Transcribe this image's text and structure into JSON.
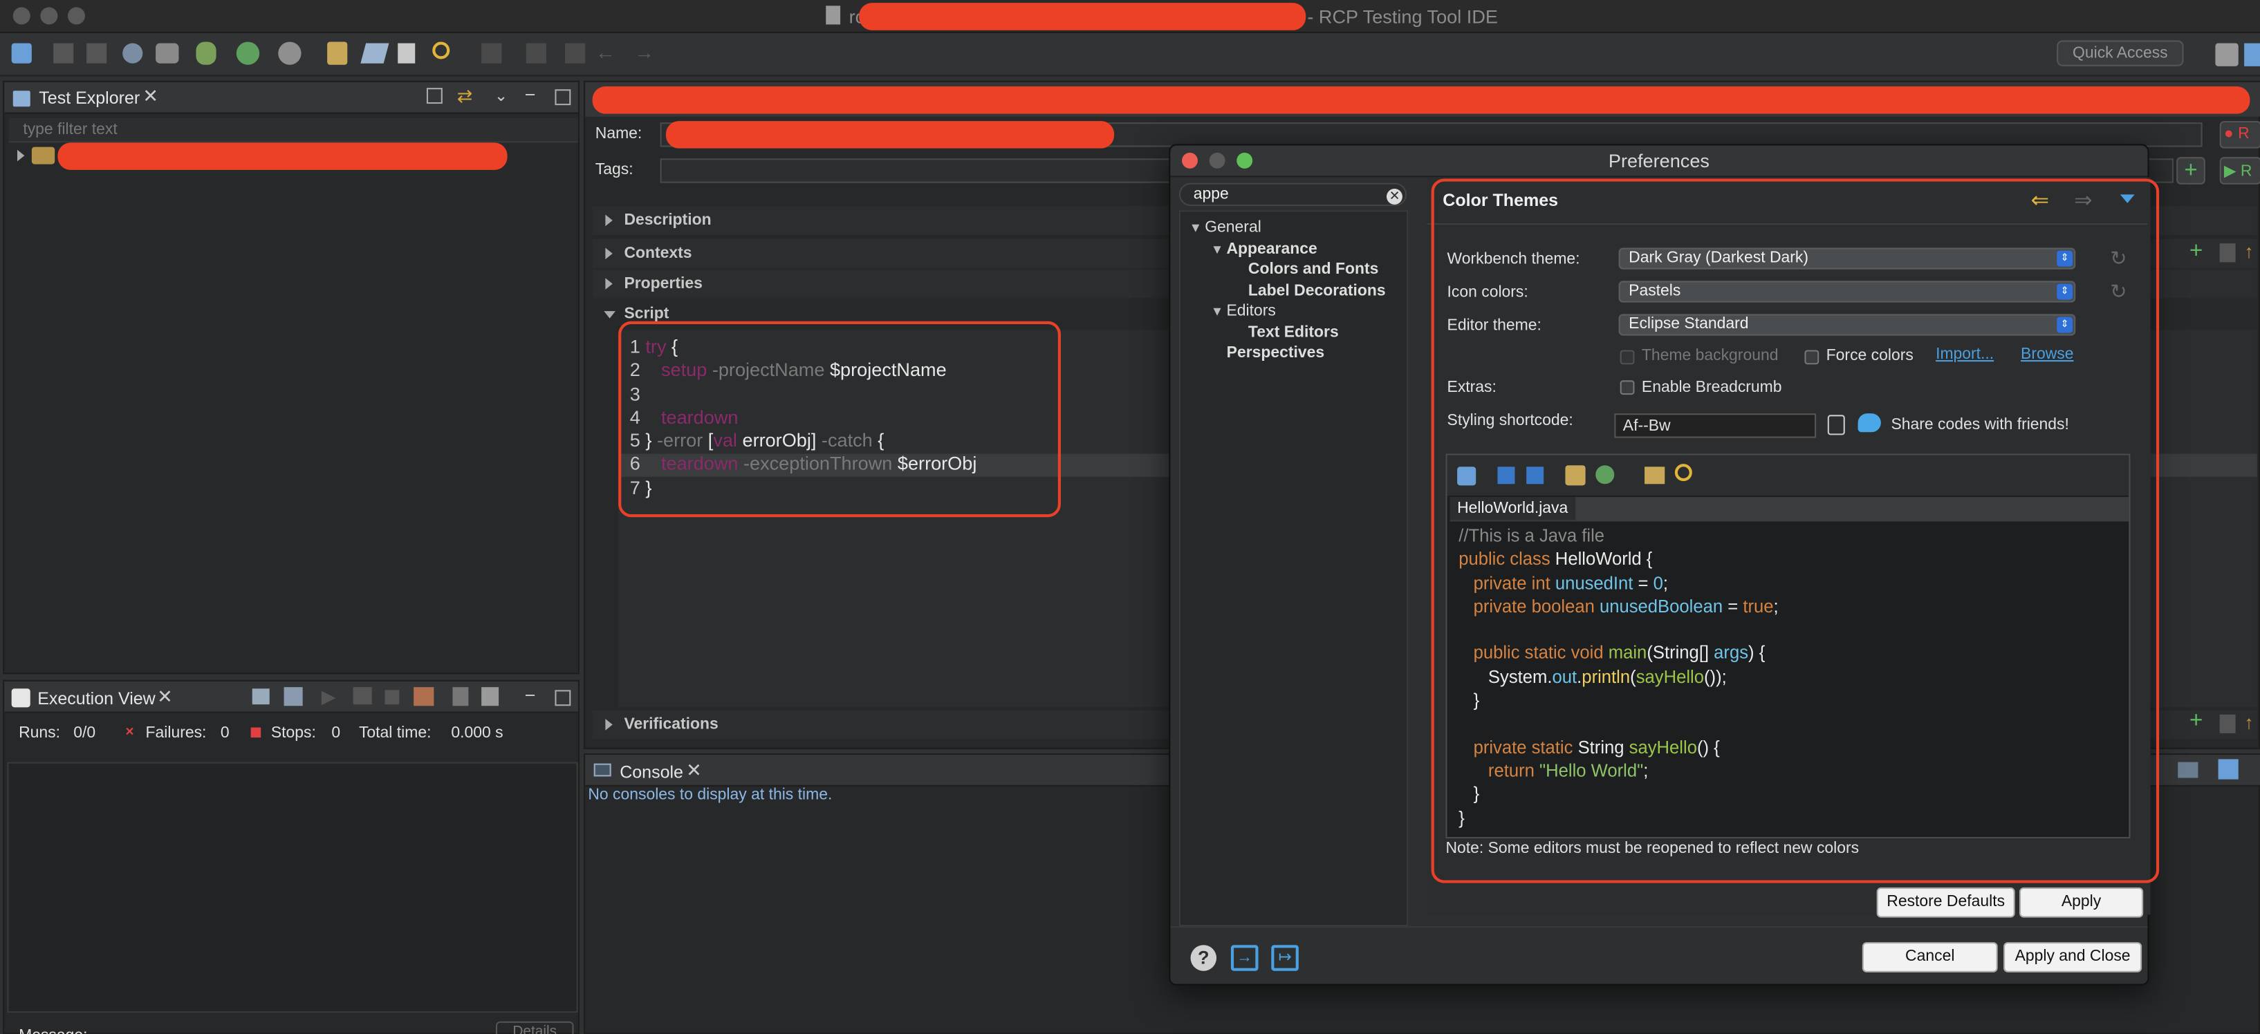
{
  "window": {
    "title": "- RCP Testing Tool IDE",
    "title_prefix": "rc"
  },
  "toolbar": {
    "quick_access": "Quick Access"
  },
  "test_explorer": {
    "tab": "Test Explorer",
    "filter_placeholder": "type filter text"
  },
  "editor": {
    "name_label": "Name:",
    "tags_label": "Tags:",
    "sections": {
      "description": "Description",
      "contexts": "Contexts",
      "properties": "Properties",
      "script": "Script",
      "verifications": "Verifications"
    },
    "script_lines": [
      {
        "n": "1",
        "parts": [
          [
            "kw",
            "try"
          ],
          [
            "wh",
            " {"
          ]
        ]
      },
      {
        "n": "2",
        "parts": [
          [
            "wh",
            "   "
          ],
          [
            "kw",
            "setup"
          ],
          [
            "dim",
            " -projectName"
          ],
          [
            "wh",
            " $projectName"
          ]
        ]
      },
      {
        "n": "3",
        "parts": []
      },
      {
        "n": "4",
        "parts": [
          [
            "wh",
            "   "
          ],
          [
            "kw",
            "teardown"
          ]
        ]
      },
      {
        "n": "5",
        "parts": [
          [
            "wh",
            "} "
          ],
          [
            "dim",
            "-error"
          ],
          [
            "wh",
            " ["
          ],
          [
            "kw",
            "val"
          ],
          [
            "wh",
            " errorObj] "
          ],
          [
            "dim",
            "-catch"
          ],
          [
            "wh",
            " {"
          ]
        ]
      },
      {
        "n": "6",
        "parts": [
          [
            "wh",
            "   "
          ],
          [
            "kw",
            "teardown"
          ],
          [
            "dim",
            " -exceptionThrown"
          ],
          [
            "wh",
            " $errorObj"
          ]
        ]
      },
      {
        "n": "7",
        "parts": [
          [
            "wh",
            "}"
          ]
        ]
      }
    ]
  },
  "execution_view": {
    "tab": "Execution View",
    "runs_label": "Runs:",
    "runs_value": "0/0",
    "failures_label": "Failures:",
    "failures_value": "0",
    "stops_label": "Stops:",
    "stops_value": "0",
    "total_time_label": "Total time:",
    "total_time_value": "0.000 s",
    "message_label": "Message:",
    "details_button": "Details"
  },
  "console": {
    "tab": "Console",
    "message": "No consoles to display at this time."
  },
  "preferences": {
    "title": "Preferences",
    "search_value": "appe",
    "tree": [
      {
        "label": "General",
        "level": 0,
        "expanded": true,
        "bold": false
      },
      {
        "label": "Appearance",
        "level": 1,
        "expanded": true,
        "bold": true
      },
      {
        "label": "Colors and Fonts",
        "level": 2,
        "expanded": false,
        "bold": true
      },
      {
        "label": "Label Decorations",
        "level": 2,
        "expanded": false,
        "bold": true
      },
      {
        "label": "Editors",
        "level": 1,
        "expanded": true,
        "bold": false
      },
      {
        "label": "Text Editors",
        "level": 2,
        "expanded": false,
        "bold": true
      },
      {
        "label": "Perspectives",
        "level": 1,
        "expanded": false,
        "bold": true
      }
    ],
    "page_title": "Color Themes",
    "workbench_theme_label": "Workbench theme:",
    "workbench_theme_value": "Dark Gray (Darkest Dark)",
    "icon_colors_label": "Icon colors:",
    "icon_colors_value": "Pastels",
    "editor_theme_label": "Editor theme:",
    "editor_theme_value": "Eclipse Standard",
    "theme_background_label": "Theme background",
    "force_colors_label": "Force colors",
    "import_link": "Import...",
    "browse_link": "Browse",
    "extras_label": "Extras:",
    "enable_breadcrumb_label": "Enable Breadcrumb",
    "styling_shortcode_label": "Styling shortcode:",
    "styling_shortcode_value": "Af--Bw",
    "share_label": "Share codes with friends!",
    "preview_tab": "HelloWorld.java",
    "preview_lines": [
      [
        [
          "jgy",
          "//This is a Java file"
        ]
      ],
      [
        [
          "jor",
          "public class"
        ],
        [
          "jw",
          " HelloWorld {"
        ]
      ],
      [
        [
          "jw",
          "   "
        ],
        [
          "jor",
          "private int"
        ],
        [
          "jcy",
          " unusedInt"
        ],
        [
          "jw",
          " = "
        ],
        [
          "jcy",
          "0"
        ],
        [
          "jw",
          ";"
        ]
      ],
      [
        [
          "jw",
          "   "
        ],
        [
          "jor",
          "private boolean"
        ],
        [
          "jcy",
          " unusedBoolean"
        ],
        [
          "jw",
          " = "
        ],
        [
          "jor",
          "true"
        ],
        [
          "jw",
          ";"
        ]
      ],
      [],
      [
        [
          "jw",
          "   "
        ],
        [
          "jor",
          "public static void"
        ],
        [
          "jgr",
          " main"
        ],
        [
          "jw",
          "(String[] "
        ],
        [
          "jcy",
          "args"
        ],
        [
          "jw",
          ") {"
        ]
      ],
      [
        [
          "jw",
          "      System."
        ],
        [
          "jcy",
          "out"
        ],
        [
          "jw",
          "."
        ],
        [
          "jyl",
          "println"
        ],
        [
          "jw",
          "("
        ],
        [
          "jgr",
          "sayHello"
        ],
        [
          "jw",
          "());"
        ]
      ],
      [
        [
          "jw",
          "   }"
        ]
      ],
      [],
      [
        [
          "jw",
          "   "
        ],
        [
          "jor",
          "private static"
        ],
        [
          "jw",
          " String "
        ],
        [
          "jgr",
          "sayHello"
        ],
        [
          "jw",
          "() {"
        ]
      ],
      [
        [
          "jw",
          "      "
        ],
        [
          "jor",
          "return"
        ],
        [
          "jgn",
          " \"Hello World\""
        ],
        [
          "jw",
          ";"
        ]
      ],
      [
        [
          "jw",
          "   }"
        ]
      ],
      [
        [
          "jw",
          "}"
        ]
      ]
    ],
    "note": "Note: Some editors must be reopened to reflect new colors",
    "restore_defaults": "Restore Defaults",
    "apply": "Apply",
    "cancel": "Cancel",
    "apply_and_close": "Apply and Close"
  },
  "colors": {
    "annotation_red": "#e8412b",
    "accent_blue": "#2f6fd8",
    "keyword": "#8c2a6b"
  }
}
